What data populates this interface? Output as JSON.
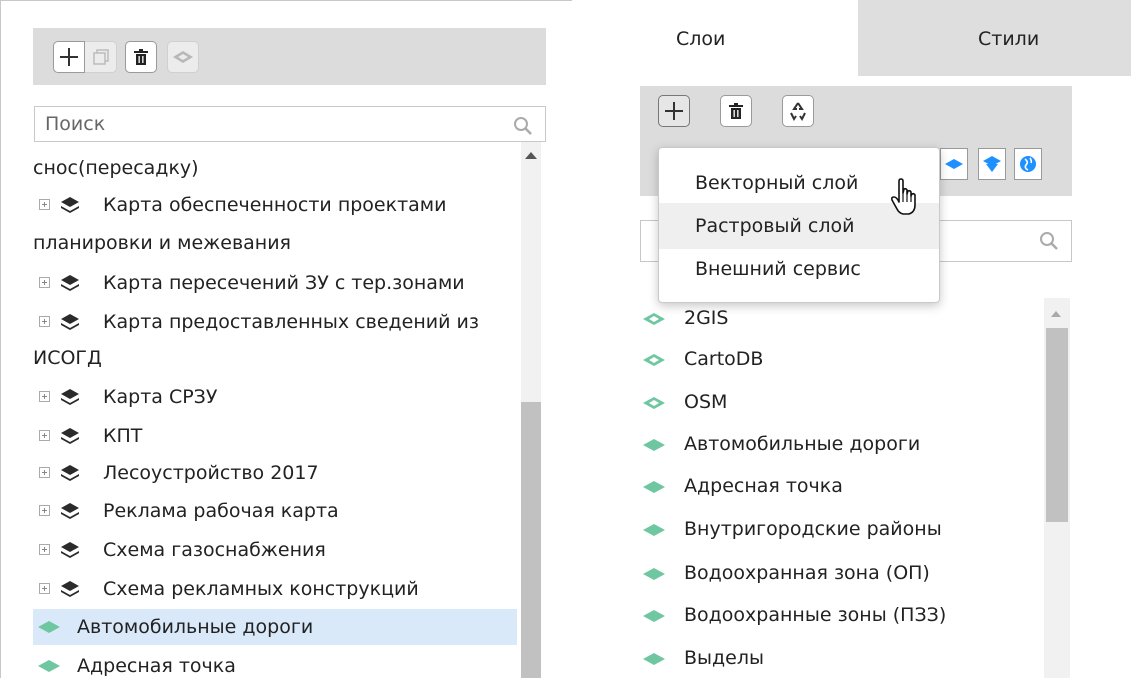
{
  "left": {
    "search_placeholder": "Поиск",
    "rows": [
      "снос(пересадку)",
      "Карта обеспеченности проектами",
      "планировки и межевания",
      "Карта пересечений ЗУ с тер.зонами",
      "Карта предоставленных сведений из",
      "ИСОГД",
      "Карта СРЗУ",
      "КПТ",
      "Лесоустройство 2017",
      "Реклама рабочая карта",
      "Схема газоснабжения",
      "Схема рекламных конструкций",
      "Автомобильные дороги",
      "Адресная точка"
    ]
  },
  "tabs": {
    "layers": "Слои",
    "styles": "Стили"
  },
  "dropdown": {
    "items": [
      "Векторный слой",
      "Растровый слой",
      "Внешний сервис"
    ]
  },
  "right": {
    "search_value": "",
    "rows": [
      "2GIS",
      "CartoDB",
      "OSM",
      "Автомобильные дороги",
      "Адресная точка",
      "Внутригородские районы",
      "Водоохранная зона (ОП)",
      "Водоохранные зоны (ПЗЗ)",
      "Выделы"
    ]
  },
  "colors": {
    "accent_blue": "#1e90ff",
    "layer_green": "#6fc7a1",
    "highlight": "#dae9fa"
  }
}
